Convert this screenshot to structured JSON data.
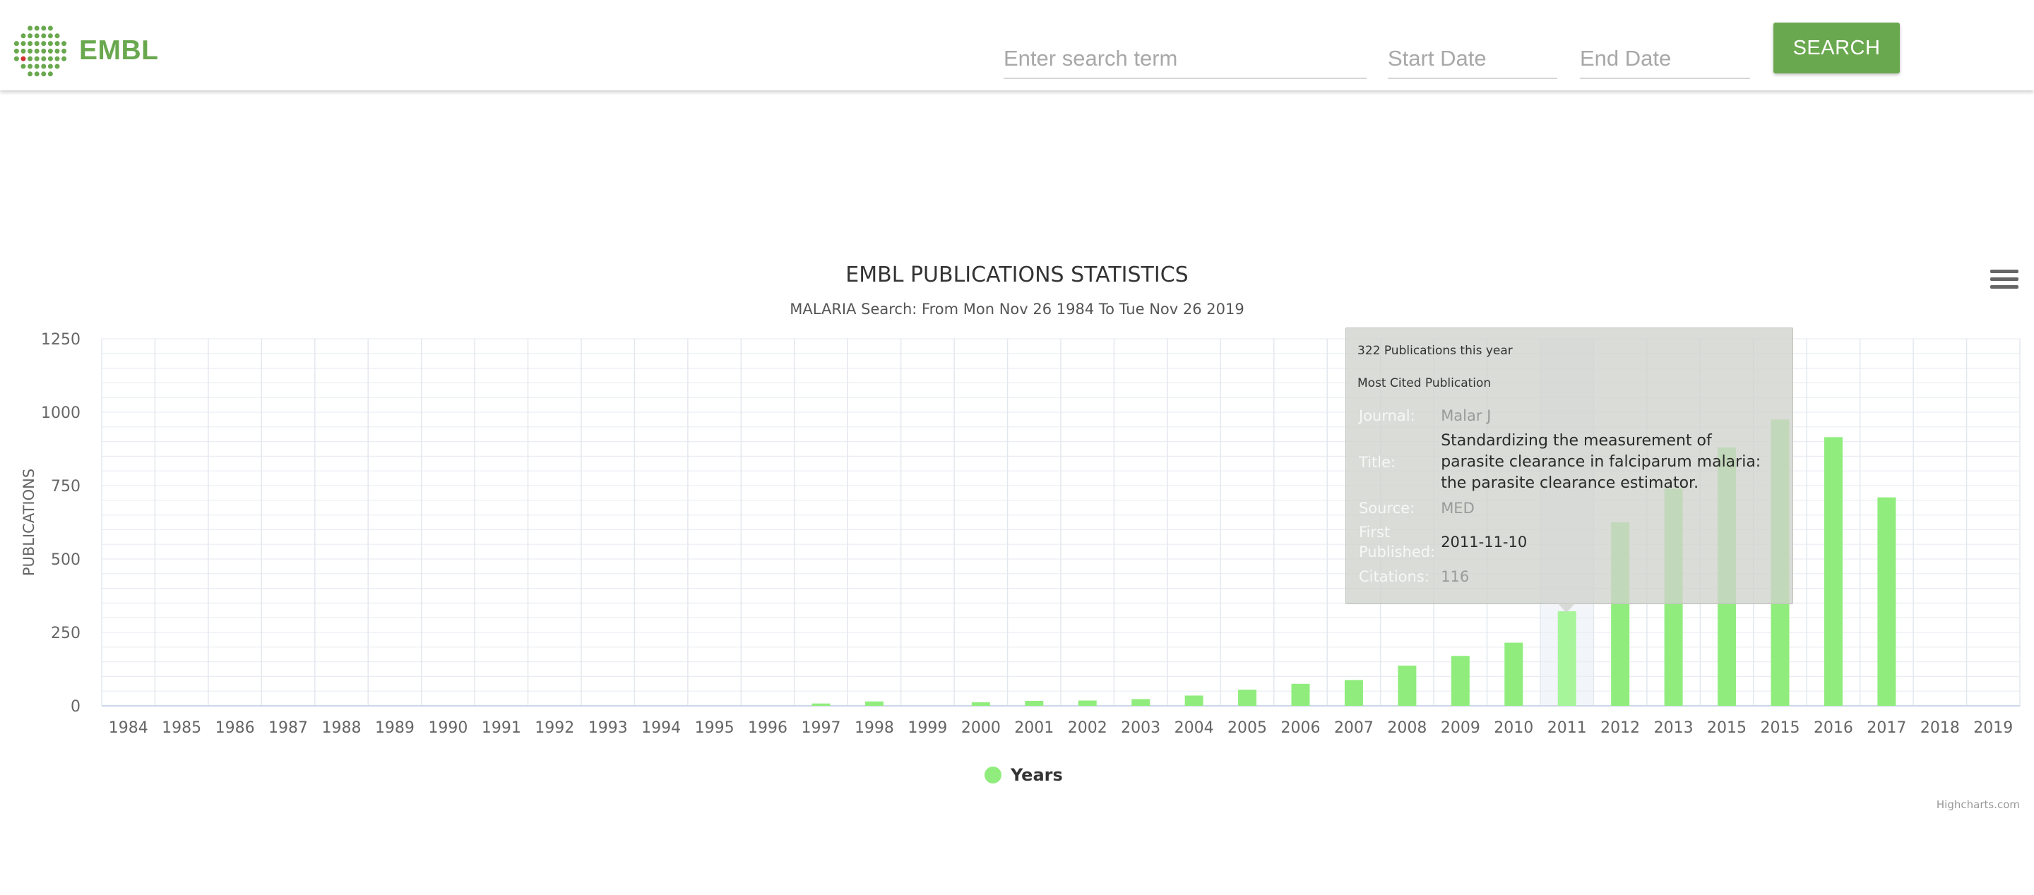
{
  "header": {
    "brand": "EMBL",
    "search_placeholder": "Enter search term",
    "start_placeholder": "Start Date",
    "end_placeholder": "End Date",
    "search_label": "SEARCH"
  },
  "chart_data": {
    "type": "bar",
    "title": "EMBL PUBLICATIONS STATISTICS",
    "subtitle": "MALARIA Search: From Mon Nov 26 1984 To Tue Nov 26 2019",
    "ylabel": "PUBLICATIONS",
    "xlabel": "",
    "ylim": [
      0,
      1250
    ],
    "yticks": [
      "0",
      "250",
      "500",
      "750",
      "1000",
      "1250"
    ],
    "categories": [
      "1984",
      "1985",
      "1986",
      "1987",
      "1988",
      "1989",
      "1990",
      "1991",
      "1992",
      "1993",
      "1994",
      "1995",
      "1996",
      "1997",
      "1998",
      "1999",
      "2000",
      "2001",
      "2002",
      "2003",
      "2004",
      "2005",
      "2006",
      "2007",
      "2008",
      "2009",
      "2010",
      "2011",
      "2012",
      "2013",
      "2015",
      "2015",
      "2016",
      "2017",
      "2018",
      "2019"
    ],
    "series": [
      {
        "name": "Years",
        "values": [
          0,
          0,
          0,
          0,
          0,
          0,
          0,
          0,
          0,
          0,
          0,
          0,
          0,
          8,
          15,
          0,
          12,
          17,
          18,
          23,
          35,
          55,
          75,
          88,
          137,
          170,
          215,
          322,
          625,
          740,
          880,
          975,
          915,
          710,
          0,
          0
        ]
      }
    ],
    "grid": true,
    "legend": "bottom-center",
    "highlighted_index": 27,
    "colors": {
      "bar": "#90ed7d",
      "bar_hover": "#a6f59a",
      "grid": "#e6e6e6",
      "title": "#333333",
      "label": "#666666"
    },
    "credits": "Highcharts.com"
  },
  "tooltip": {
    "headline": "322 Publications this year",
    "subhead": "Most Cited Publication",
    "journal_key": "Journal:",
    "journal_val": "Malar J",
    "title_key": "Title:",
    "title_val": "Standardizing the measurement of parasite clearance in falciparum malaria: the parasite clearance estimator.",
    "source_key": "Source:",
    "source_val": "MED",
    "first_key": "First Published:",
    "first_val": "2011-11-10",
    "citations_key": "Citations:",
    "citations_val": "116"
  },
  "icons": {
    "menu": "hamburger-menu-icon",
    "logo": "embl-logo-icon"
  }
}
